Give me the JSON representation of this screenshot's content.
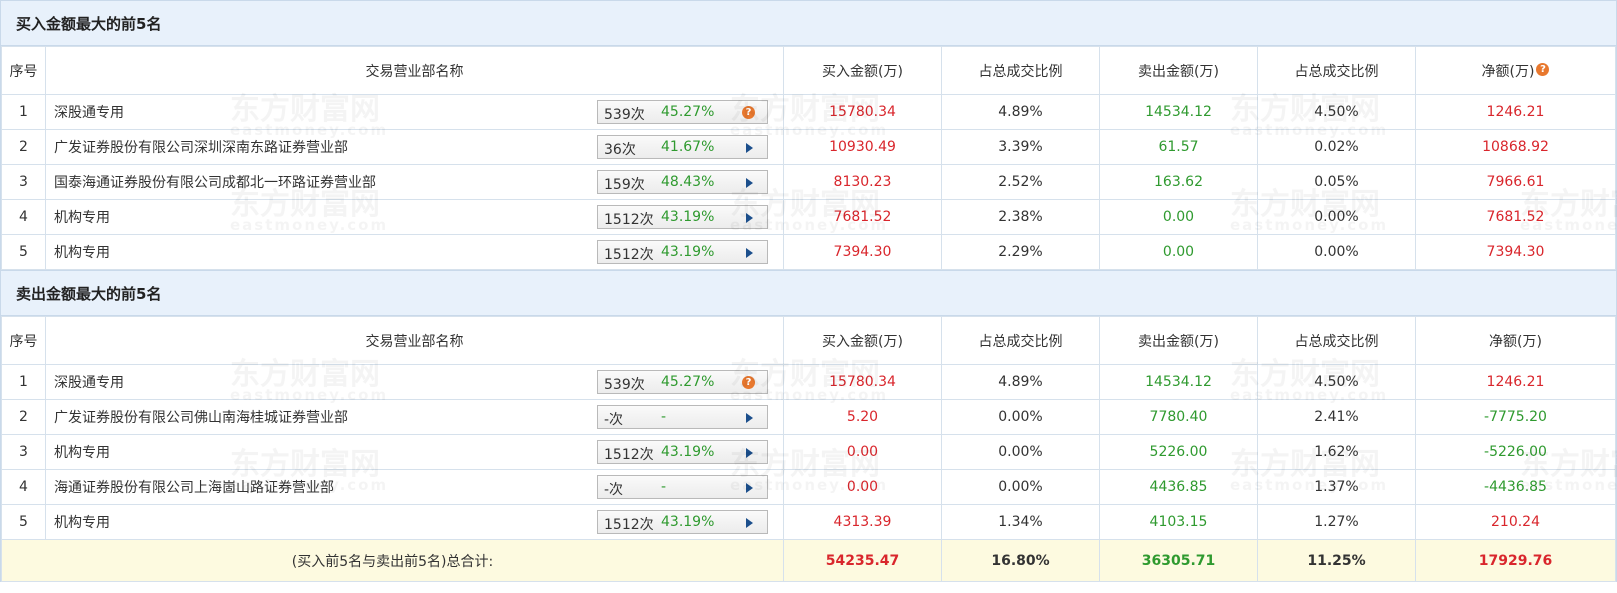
{
  "watermark": {
    "brand": "东方财富网",
    "domain": "eastmoney.com"
  },
  "buy_section": {
    "title": "买入金额最大的前5名",
    "headers": {
      "idx": "序号",
      "name": "交易营业部名称",
      "buy": "买入金额(万)",
      "buy_ratio": "占总成交比例",
      "sell": "卖出金额(万)",
      "sell_ratio": "占总成交比例",
      "net": "净额(万)"
    },
    "rows": [
      {
        "idx": "1",
        "name": "深股通专用",
        "count": "539次",
        "pct": "45.27%",
        "btn": "help",
        "buy": "15780.34",
        "buy_ratio": "4.89%",
        "sell": "14534.12",
        "sell_ratio": "4.50%",
        "net": "1246.21",
        "net_color": "red"
      },
      {
        "idx": "2",
        "name": "广发证券股份有限公司深圳深南东路证券营业部",
        "count": "36次",
        "pct": "41.67%",
        "btn": "arrow",
        "buy": "10930.49",
        "buy_ratio": "3.39%",
        "sell": "61.57",
        "sell_ratio": "0.02%",
        "net": "10868.92",
        "net_color": "red"
      },
      {
        "idx": "3",
        "name": "国泰海通证券股份有限公司成都北一环路证券营业部",
        "count": "159次",
        "pct": "48.43%",
        "btn": "arrow",
        "buy": "8130.23",
        "buy_ratio": "2.52%",
        "sell": "163.62",
        "sell_ratio": "0.05%",
        "net": "7966.61",
        "net_color": "red"
      },
      {
        "idx": "4",
        "name": "机构专用",
        "count": "1512次",
        "pct": "43.19%",
        "btn": "arrow",
        "buy": "7681.52",
        "buy_ratio": "2.38%",
        "sell": "0.00",
        "sell_ratio": "0.00%",
        "net": "7681.52",
        "net_color": "red"
      },
      {
        "idx": "5",
        "name": "机构专用",
        "count": "1512次",
        "pct": "43.19%",
        "btn": "arrow",
        "buy": "7394.30",
        "buy_ratio": "2.29%",
        "sell": "0.00",
        "sell_ratio": "0.00%",
        "net": "7394.30",
        "net_color": "red"
      }
    ]
  },
  "sell_section": {
    "title": "卖出金额最大的前5名",
    "headers": {
      "idx": "序号",
      "name": "交易营业部名称",
      "buy": "买入金额(万)",
      "buy_ratio": "占总成交比例",
      "sell": "卖出金额(万)",
      "sell_ratio": "占总成交比例",
      "net": "净额(万)"
    },
    "rows": [
      {
        "idx": "1",
        "name": "深股通专用",
        "count": "539次",
        "pct": "45.27%",
        "btn": "help",
        "buy": "15780.34",
        "buy_ratio": "4.89%",
        "sell": "14534.12",
        "sell_ratio": "4.50%",
        "net": "1246.21",
        "net_color": "red"
      },
      {
        "idx": "2",
        "name": "广发证券股份有限公司佛山南海桂城证券营业部",
        "count": "-次",
        "pct": "-",
        "btn": "arrow",
        "buy": "5.20",
        "buy_ratio": "0.00%",
        "sell": "7780.40",
        "sell_ratio": "2.41%",
        "net": "-7775.20",
        "net_color": "green"
      },
      {
        "idx": "3",
        "name": "机构专用",
        "count": "1512次",
        "pct": "43.19%",
        "btn": "arrow",
        "buy": "0.00",
        "buy_ratio": "0.00%",
        "sell": "5226.00",
        "sell_ratio": "1.62%",
        "net": "-5226.00",
        "net_color": "green"
      },
      {
        "idx": "4",
        "name": "海通证券股份有限公司上海崮山路证券营业部",
        "count": "-次",
        "pct": "-",
        "btn": "arrow",
        "buy": "0.00",
        "buy_ratio": "0.00%",
        "sell": "4436.85",
        "sell_ratio": "1.37%",
        "net": "-4436.85",
        "net_color": "green"
      },
      {
        "idx": "5",
        "name": "机构专用",
        "count": "1512次",
        "pct": "43.19%",
        "btn": "arrow",
        "buy": "4313.39",
        "buy_ratio": "1.34%",
        "sell": "4103.15",
        "sell_ratio": "1.27%",
        "net": "210.24",
        "net_color": "red"
      }
    ],
    "total": {
      "label": "(买入前5名与卖出前5名)总合计:",
      "buy": "54235.47",
      "buy_ratio": "16.80%",
      "sell": "36305.71",
      "sell_ratio": "11.25%",
      "net": "17929.76"
    }
  },
  "colors": {
    "header_bg": "#e8f1fb",
    "border": "#d6e1ec",
    "red": "#d9262c",
    "green": "#2f9a2f",
    "total_bg": "#fdfae0",
    "help_orange": "#e8782e",
    "arrow_blue": "#1c4f8c"
  }
}
